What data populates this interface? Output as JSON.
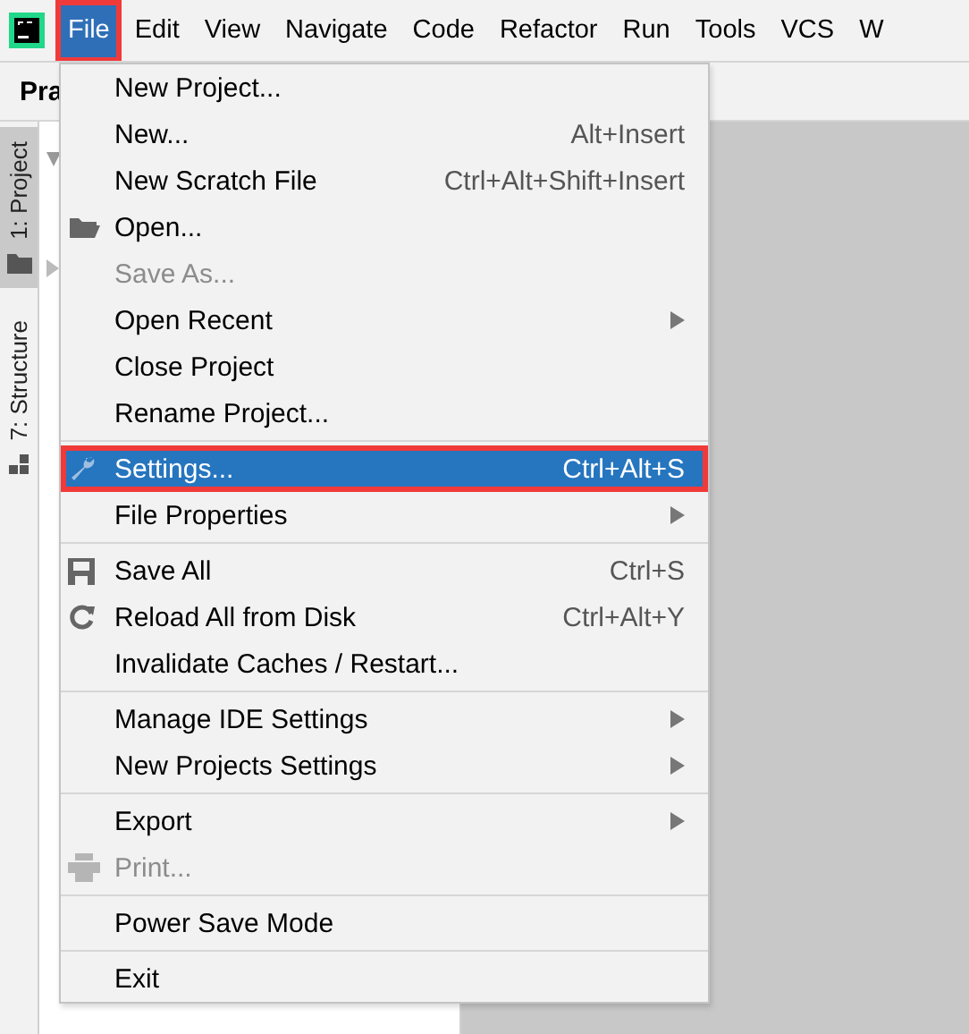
{
  "menu_bar": {
    "items": [
      {
        "label": "File",
        "selected": true,
        "annotated": true
      },
      {
        "label": "Edit",
        "selected": false,
        "annotated": false
      },
      {
        "label": "View",
        "selected": false,
        "annotated": false
      },
      {
        "label": "Navigate",
        "selected": false,
        "annotated": false
      },
      {
        "label": "Code",
        "selected": false,
        "annotated": false
      },
      {
        "label": "Refactor",
        "selected": false,
        "annotated": false
      },
      {
        "label": "Run",
        "selected": false,
        "annotated": false
      },
      {
        "label": "Tools",
        "selected": false,
        "annotated": false
      },
      {
        "label": "VCS",
        "selected": false,
        "annotated": false
      },
      {
        "label": "W",
        "selected": false,
        "annotated": false
      }
    ]
  },
  "tool_window_strip": {
    "tabs": [
      {
        "label": "1: Project",
        "selected": true
      },
      {
        "label": "7: Structure",
        "selected": false
      }
    ]
  },
  "project_panel": {
    "title": "Pra"
  },
  "file_menu": {
    "groups": [
      {
        "items": [
          {
            "label": "New Project...",
            "submenu": false,
            "disabled": false,
            "selected": false,
            "annotated": false
          },
          {
            "label": "New...",
            "shortcut": "Alt+Insert",
            "submenu": false,
            "disabled": false,
            "selected": false,
            "annotated": false
          },
          {
            "label": "New Scratch File",
            "shortcut": "Ctrl+Alt+Shift+Insert",
            "submenu": false,
            "disabled": false,
            "selected": false,
            "annotated": false
          },
          {
            "label": "Open...",
            "submenu": false,
            "disabled": false,
            "selected": false,
            "annotated": false
          },
          {
            "label": "Save As...",
            "submenu": false,
            "disabled": true,
            "selected": false,
            "annotated": false
          },
          {
            "label": "Open Recent",
            "submenu": true,
            "disabled": false,
            "selected": false,
            "annotated": false
          },
          {
            "label": "Close Project",
            "submenu": false,
            "disabled": false,
            "selected": false,
            "annotated": false
          },
          {
            "label": "Rename Project...",
            "submenu": false,
            "disabled": false,
            "selected": false,
            "annotated": false
          }
        ]
      },
      {
        "items": [
          {
            "label": "Settings...",
            "shortcut": "Ctrl+Alt+S",
            "submenu": false,
            "disabled": false,
            "selected": true,
            "annotated": true
          },
          {
            "label": "File Properties",
            "submenu": true,
            "disabled": false,
            "selected": false,
            "annotated": false
          }
        ]
      },
      {
        "items": [
          {
            "label": "Save All",
            "shortcut": "Ctrl+S",
            "submenu": false,
            "disabled": false,
            "selected": false,
            "annotated": false
          },
          {
            "label": "Reload All from Disk",
            "shortcut": "Ctrl+Alt+Y",
            "submenu": false,
            "disabled": false,
            "selected": false,
            "annotated": false
          },
          {
            "label": "Invalidate Caches / Restart...",
            "submenu": false,
            "disabled": false,
            "selected": false,
            "annotated": false
          }
        ]
      },
      {
        "items": [
          {
            "label": "Manage IDE Settings",
            "submenu": true,
            "disabled": false,
            "selected": false,
            "annotated": false
          },
          {
            "label": "New Projects Settings",
            "submenu": true,
            "disabled": false,
            "selected": false,
            "annotated": false
          }
        ]
      },
      {
        "items": [
          {
            "label": "Export",
            "submenu": true,
            "disabled": false,
            "selected": false,
            "annotated": false
          },
          {
            "label": "Print...",
            "submenu": false,
            "disabled": true,
            "selected": false,
            "annotated": false
          }
        ]
      },
      {
        "items": [
          {
            "label": "Power Save Mode",
            "submenu": false,
            "disabled": false,
            "selected": false,
            "annotated": false
          }
        ]
      },
      {
        "items": [
          {
            "label": "Exit",
            "submenu": false,
            "disabled": false,
            "selected": false,
            "annotated": false
          }
        ]
      }
    ]
  }
}
